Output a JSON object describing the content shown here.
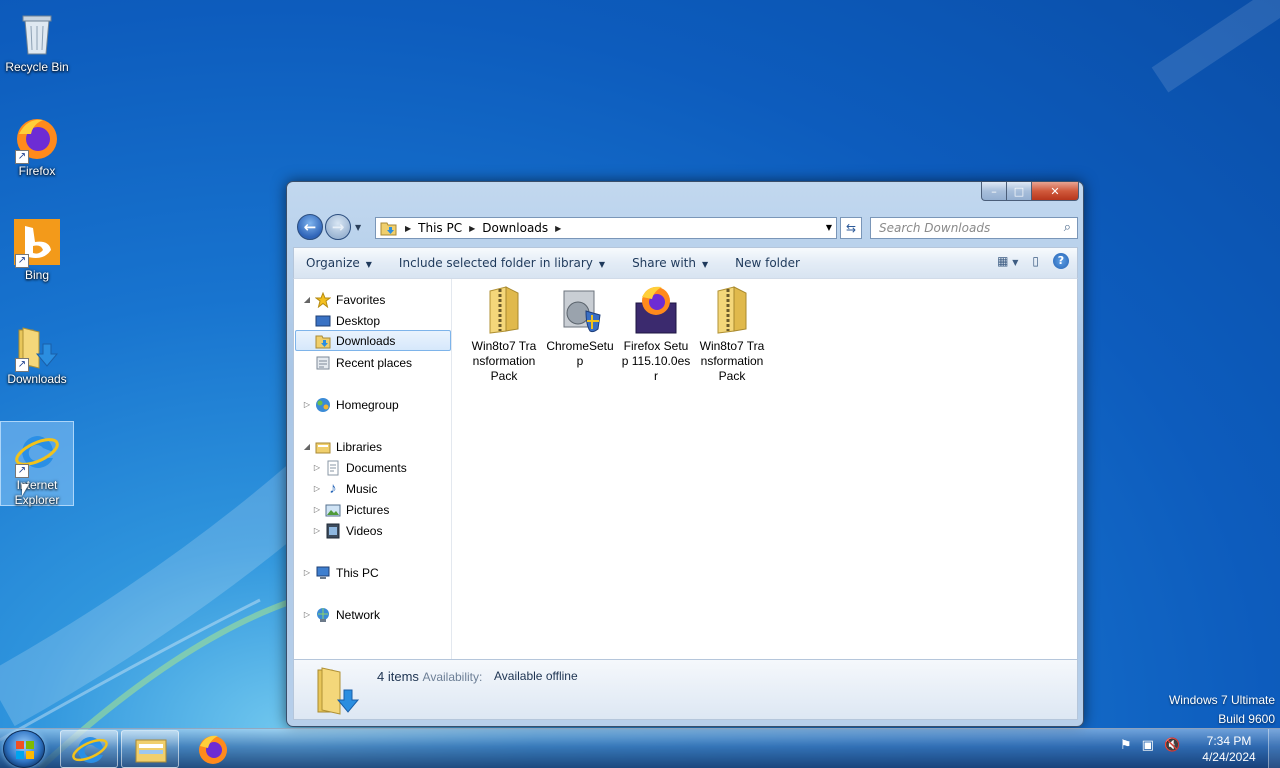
{
  "desktop": {
    "icons": [
      {
        "label": "Recycle Bin",
        "icon": "recycle-bin-icon"
      },
      {
        "label": "Firefox",
        "icon": "firefox-icon"
      },
      {
        "label": "Bing",
        "icon": "bing-icon"
      },
      {
        "label": "Downloads",
        "icon": "downloads-folder-icon"
      },
      {
        "label": "Internet Explorer",
        "icon": "internet-explorer-icon"
      }
    ],
    "watermark_line1": "Windows 7 Ultimate",
    "watermark_line2": "Build 9600"
  },
  "explorer": {
    "controls": {
      "minimize": "–",
      "maximize": "□",
      "close": "✕"
    },
    "address": {
      "parts": [
        "This PC",
        "Downloads"
      ]
    },
    "search": {
      "placeholder": "Search Downloads"
    },
    "toolbar": {
      "organize": "Organize",
      "include_library": "Include selected folder in library",
      "share_with": "Share with",
      "new_folder": "New folder"
    },
    "nav": {
      "favorites": "Favorites",
      "desktop": "Desktop",
      "downloads": "Downloads",
      "recent": "Recent places",
      "homegroup": "Homegroup",
      "libraries": "Libraries",
      "documents": "Documents",
      "music": "Music",
      "pictures": "Pictures",
      "videos": "Videos",
      "this_pc": "This PC",
      "network": "Network"
    },
    "files": [
      {
        "name": "Win8to7 Transformation Pack",
        "icon": "zip-folder-icon"
      },
      {
        "name": "ChromeSetup",
        "icon": "installer-icon"
      },
      {
        "name": "Firefox Setup 115.10.0esr",
        "icon": "firefox-installer-icon"
      },
      {
        "name": "Win8to7 Transformation Pack",
        "icon": "zip-folder-icon"
      }
    ],
    "status": {
      "count": "4 items",
      "availability_label": "Availability:",
      "availability_value": "Available offline"
    }
  },
  "taskbar": {
    "time": "7:34 PM",
    "date": "4/24/2024",
    "pinned": [
      "internet-explorer-icon",
      "file-explorer-icon",
      "firefox-icon"
    ]
  },
  "colors": {
    "accent": "#1874cf",
    "selection": "#d6e8fb"
  }
}
